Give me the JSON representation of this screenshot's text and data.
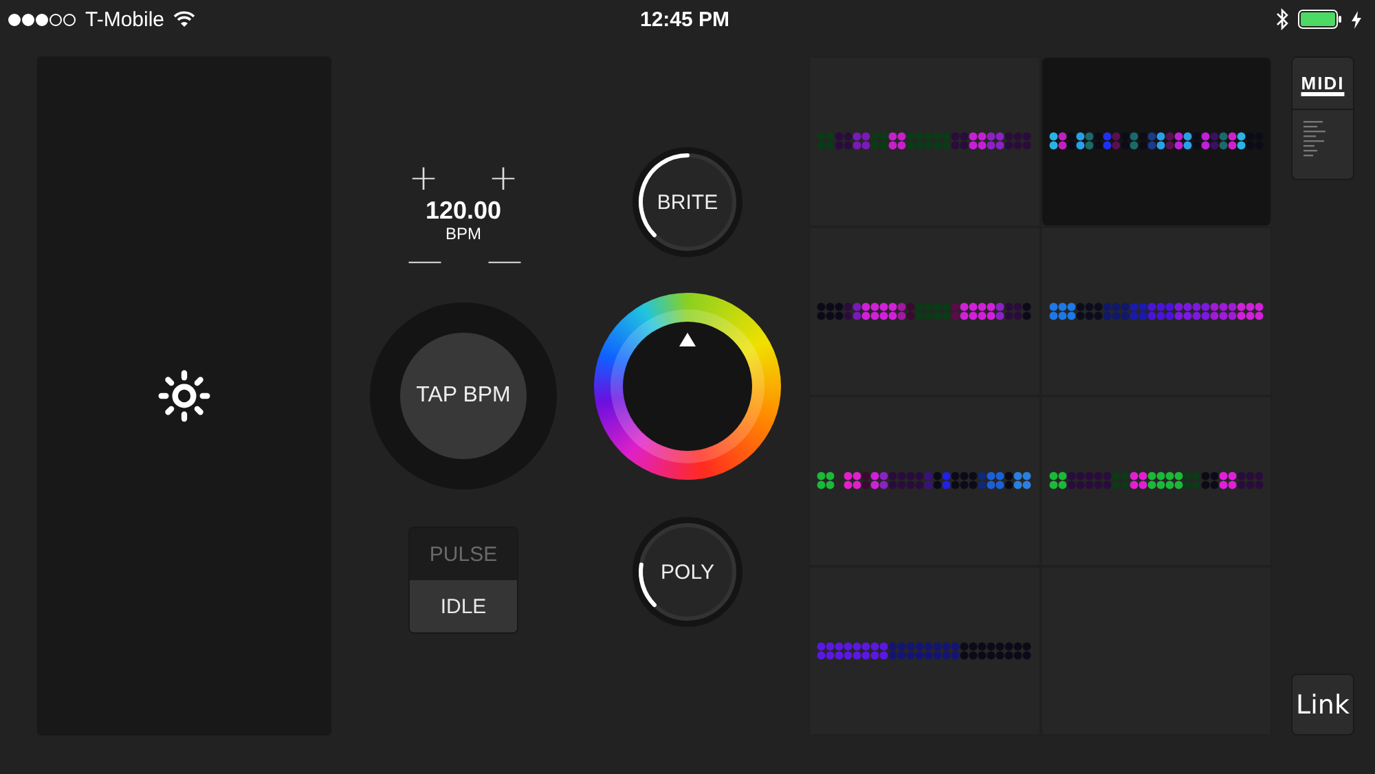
{
  "status_bar": {
    "carrier": "T-Mobile",
    "time": "12:45 PM"
  },
  "tempo": {
    "increment_left": "+",
    "increment_right": "+",
    "value": "120.00",
    "unit": "BPM",
    "decrement_left": "—",
    "decrement_right": "—",
    "tap_label": "TAP BPM"
  },
  "modes": [
    {
      "label": "PULSE",
      "selected": false
    },
    {
      "label": "IDLE",
      "selected": true
    }
  ],
  "knobs": [
    {
      "label": "BRITE",
      "level": 0.5
    },
    {
      "label": "POLY",
      "level": 0.2
    }
  ],
  "patterns": [
    {
      "kind": "pattern",
      "selected": false
    },
    {
      "kind": "pattern",
      "selected": true
    },
    {
      "kind": "pattern",
      "selected": false
    },
    {
      "kind": "pattern",
      "selected": false
    },
    {
      "kind": "pattern",
      "selected": false
    },
    {
      "kind": "pattern",
      "selected": false
    },
    {
      "kind": "pattern",
      "selected": false
    },
    {
      "kind": "empty",
      "selected": false
    }
  ],
  "side_buttons": [
    {
      "label": "MIDI"
    },
    {
      "label": "Link"
    }
  ]
}
